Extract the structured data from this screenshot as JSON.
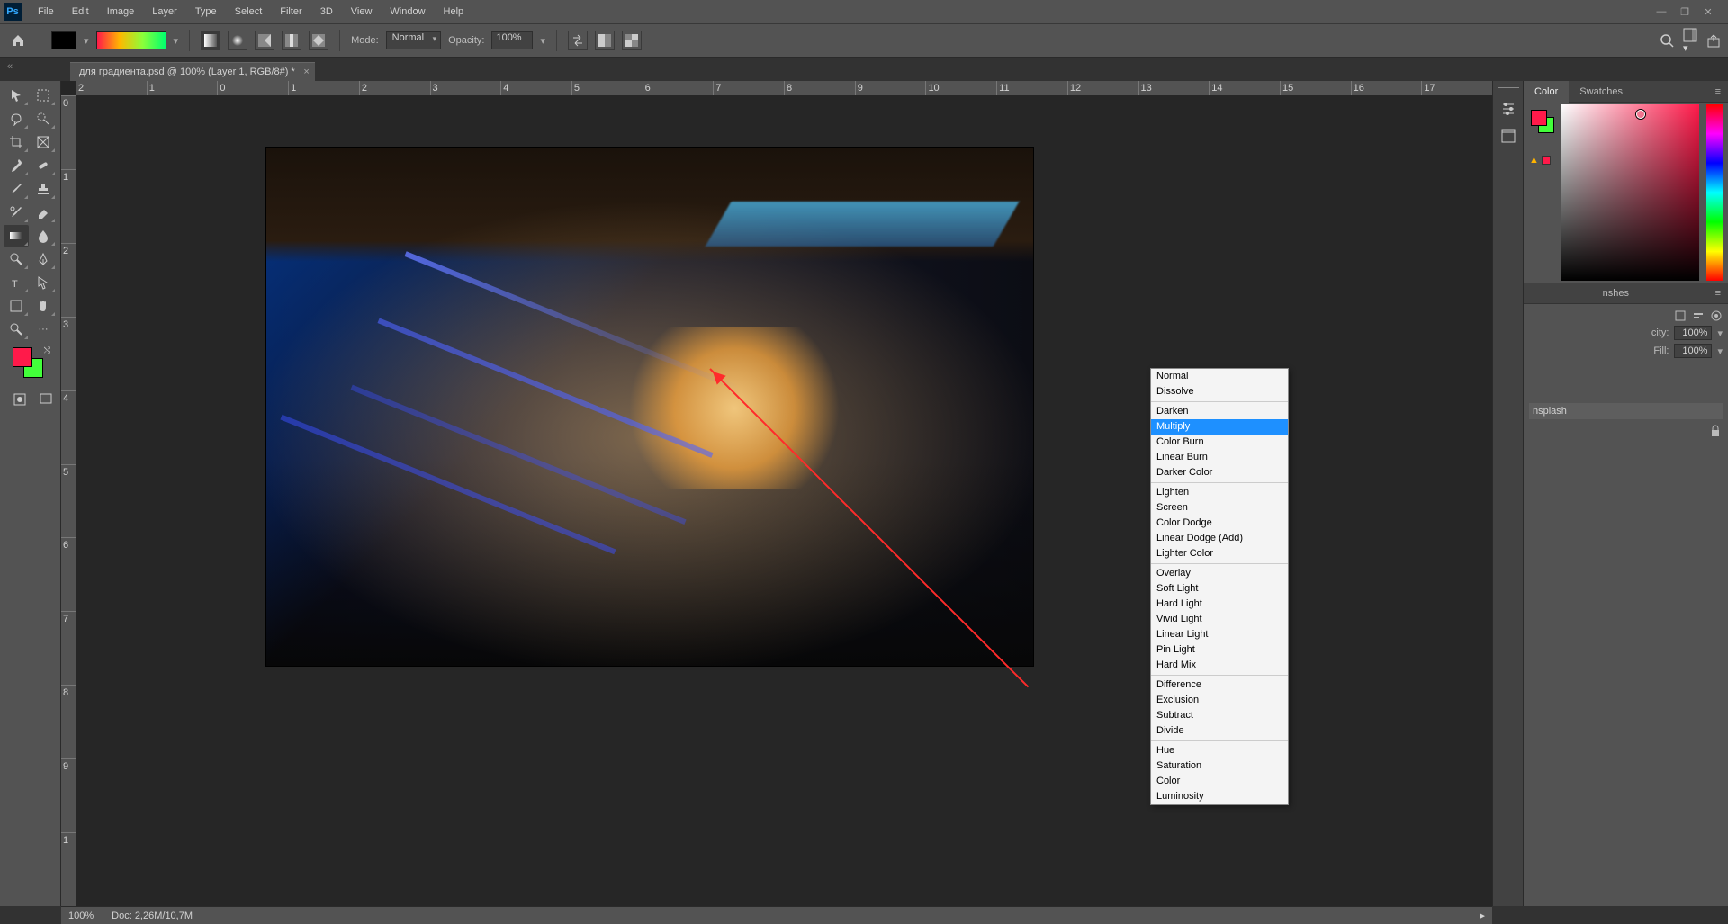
{
  "menu": {
    "items": [
      "File",
      "Edit",
      "Image",
      "Layer",
      "Type",
      "Select",
      "Filter",
      "3D",
      "View",
      "Window",
      "Help"
    ]
  },
  "options": {
    "mode_label": "Mode:",
    "mode_value": "Normal",
    "opacity_label": "Opacity:",
    "opacity_value": "100%"
  },
  "document": {
    "tab_title": "для градиента.psd @ 100% (Layer 1, RGB/8#) *"
  },
  "ruler_h": [
    "2",
    "1",
    "0",
    "1",
    "2",
    "3",
    "4",
    "5",
    "6",
    "7",
    "8",
    "9",
    "10",
    "11",
    "12",
    "13",
    "14",
    "15",
    "16",
    "17"
  ],
  "ruler_v": [
    "0",
    "1",
    "2",
    "3",
    "4",
    "5",
    "6",
    "7",
    "8",
    "9",
    "1"
  ],
  "color_panel": {
    "tabs": [
      "Color",
      "Swatches"
    ],
    "active": 0
  },
  "layers": {
    "tabs_label": "nshes",
    "opacity_label": "city:",
    "opacity_value": "100%",
    "fill_label": "Fill:",
    "fill_value": "100%",
    "visible_layer": "nsplash"
  },
  "blend_modes": {
    "groups": [
      [
        "Normal",
        "Dissolve"
      ],
      [
        "Darken",
        "Multiply",
        "Color Burn",
        "Linear Burn",
        "Darker Color"
      ],
      [
        "Lighten",
        "Screen",
        "Color Dodge",
        "Linear Dodge (Add)",
        "Lighter Color"
      ],
      [
        "Overlay",
        "Soft Light",
        "Hard Light",
        "Vivid Light",
        "Linear Light",
        "Pin Light",
        "Hard Mix"
      ],
      [
        "Difference",
        "Exclusion",
        "Subtract",
        "Divide"
      ],
      [
        "Hue",
        "Saturation",
        "Color",
        "Luminosity"
      ]
    ],
    "selected": "Multiply"
  },
  "status": {
    "zoom": "100%",
    "doc": "Doc: 2,26M/10,7M"
  },
  "colors": {
    "fg": "#ff1a4a",
    "bg": "#42ff3a"
  }
}
